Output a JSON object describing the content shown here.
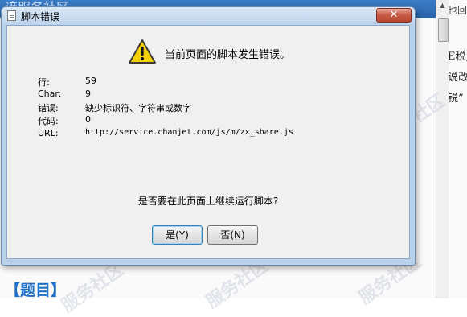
{
  "background": {
    "top_bar_text": "谛服务社区",
    "right_top_text": "也回",
    "right_lines": [
      "E税,",
      "说改",
      "锐”"
    ],
    "heading": "【题目】",
    "watermark": "服务社区"
  },
  "dialog": {
    "title": "脚本错误",
    "close_label": "✕",
    "message": "当前页面的脚本发生错误。",
    "fields": [
      {
        "label": "行:",
        "value": "59"
      },
      {
        "label": "Char:",
        "value": "9"
      },
      {
        "label": "错误:",
        "value": "缺少标识符、字符串或数字"
      },
      {
        "label": "代码:",
        "value": "0"
      },
      {
        "label": "URL:",
        "value": "http://service.chanjet.com/js/m/zx_share.js"
      }
    ],
    "question": "是否要在此页面上继续运行脚本?",
    "yes_label": "是(Y)",
    "no_label": "否(N)"
  },
  "colors": {
    "dialog_frame": "#b9d1ea",
    "close_button": "#c75a44",
    "warning_yellow": "#f5d000"
  },
  "icons": {
    "warning": "warning-icon",
    "title": "script-page-icon",
    "close": "close-icon"
  }
}
